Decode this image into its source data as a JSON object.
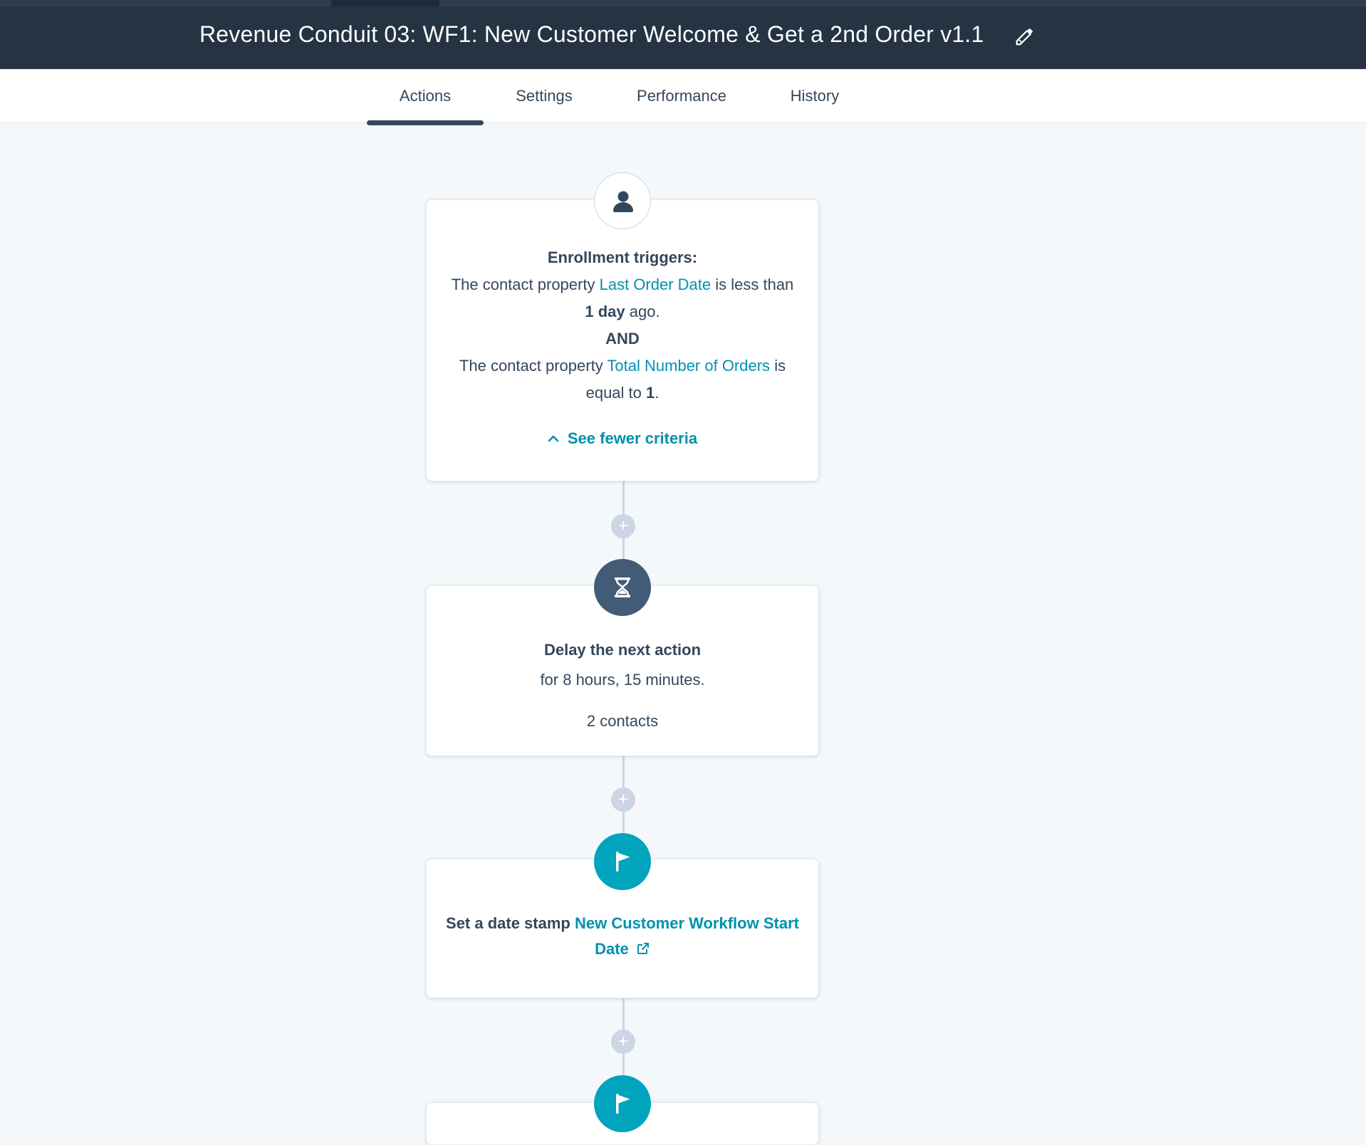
{
  "header": {
    "title": "Revenue Conduit 03: WF1: New Customer Welcome & Get a 2nd Order v1.1"
  },
  "tabs": [
    {
      "label": "Actions",
      "active": true
    },
    {
      "label": "Settings",
      "active": false
    },
    {
      "label": "Performance",
      "active": false
    },
    {
      "label": "History",
      "active": false
    }
  ],
  "enrollment": {
    "heading": "Enrollment triggers:",
    "c1_prefix": "The contact property",
    "c1_property": "Last Order Date",
    "c1_op": "is less than",
    "c1_value": "1 day",
    "c1_suffix": "ago.",
    "join": "AND",
    "c2_prefix": "The contact property",
    "c2_property": "Total Number of Orders",
    "c2_op": "is",
    "c2_op2": "equal to",
    "c2_value": "1",
    "c2_suffix": ".",
    "toggle": "See fewer criteria"
  },
  "delay": {
    "heading": "Delay the next action",
    "duration": "for 8 hours, 15 minutes.",
    "count": "2 contacts"
  },
  "datestamp": {
    "heading": "Set a date stamp",
    "property_line1": "New Customer Workflow Start",
    "property_line2": "Date"
  },
  "add_action": "+",
  "colors": {
    "header_bg": "#253342",
    "page_bg": "#f5f8fa",
    "link": "#0091ae",
    "teal": "#00a4bd",
    "dark_circle": "#425b76",
    "text": "#33475b"
  },
  "icons": {
    "trigger": "person-icon",
    "delay": "hourglass-icon",
    "action": "flag-icon",
    "edit": "pencil-icon",
    "toggle": "chevron-up-icon",
    "external": "external-link-icon"
  }
}
